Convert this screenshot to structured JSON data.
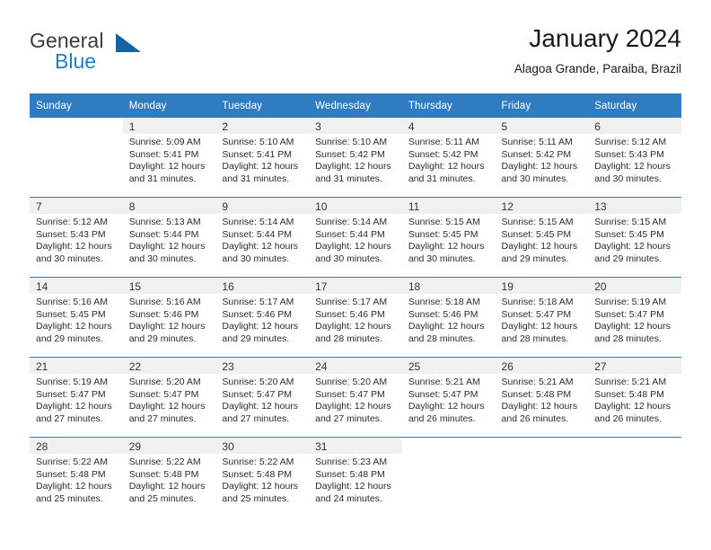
{
  "brand": {
    "name_part1": "General",
    "name_part2": "Blue",
    "mark": "triangle-logo",
    "color_primary": "#1d7dc4",
    "color_text": "#3b3b3b"
  },
  "header": {
    "title": "January 2024",
    "location": "Alagoa Grande, Paraiba, Brazil"
  },
  "theme": {
    "header_row_bg": "#2f7cc0",
    "daynum_bg": "#f0f0f0",
    "grid_line": "#2f7cc0",
    "page_bg": "#ffffff"
  },
  "calendar": {
    "weekday_headers": [
      "Sunday",
      "Monday",
      "Tuesday",
      "Wednesday",
      "Thursday",
      "Friday",
      "Saturday"
    ],
    "labels": {
      "sunrise": "Sunrise:",
      "sunset": "Sunset:",
      "daylight": "Daylight:"
    },
    "weeks": [
      [
        {
          "day": "",
          "sunrise": "",
          "sunset": "",
          "daylight_line1": "",
          "daylight_line2": ""
        },
        {
          "day": "1",
          "sunrise": "Sunrise: 5:09 AM",
          "sunset": "Sunset: 5:41 PM",
          "daylight_line1": "Daylight: 12 hours",
          "daylight_line2": "and 31 minutes."
        },
        {
          "day": "2",
          "sunrise": "Sunrise: 5:10 AM",
          "sunset": "Sunset: 5:41 PM",
          "daylight_line1": "Daylight: 12 hours",
          "daylight_line2": "and 31 minutes."
        },
        {
          "day": "3",
          "sunrise": "Sunrise: 5:10 AM",
          "sunset": "Sunset: 5:42 PM",
          "daylight_line1": "Daylight: 12 hours",
          "daylight_line2": "and 31 minutes."
        },
        {
          "day": "4",
          "sunrise": "Sunrise: 5:11 AM",
          "sunset": "Sunset: 5:42 PM",
          "daylight_line1": "Daylight: 12 hours",
          "daylight_line2": "and 31 minutes."
        },
        {
          "day": "5",
          "sunrise": "Sunrise: 5:11 AM",
          "sunset": "Sunset: 5:42 PM",
          "daylight_line1": "Daylight: 12 hours",
          "daylight_line2": "and 30 minutes."
        },
        {
          "day": "6",
          "sunrise": "Sunrise: 5:12 AM",
          "sunset": "Sunset: 5:43 PM",
          "daylight_line1": "Daylight: 12 hours",
          "daylight_line2": "and 30 minutes."
        }
      ],
      [
        {
          "day": "7",
          "sunrise": "Sunrise: 5:12 AM",
          "sunset": "Sunset: 5:43 PM",
          "daylight_line1": "Daylight: 12 hours",
          "daylight_line2": "and 30 minutes."
        },
        {
          "day": "8",
          "sunrise": "Sunrise: 5:13 AM",
          "sunset": "Sunset: 5:44 PM",
          "daylight_line1": "Daylight: 12 hours",
          "daylight_line2": "and 30 minutes."
        },
        {
          "day": "9",
          "sunrise": "Sunrise: 5:14 AM",
          "sunset": "Sunset: 5:44 PM",
          "daylight_line1": "Daylight: 12 hours",
          "daylight_line2": "and 30 minutes."
        },
        {
          "day": "10",
          "sunrise": "Sunrise: 5:14 AM",
          "sunset": "Sunset: 5:44 PM",
          "daylight_line1": "Daylight: 12 hours",
          "daylight_line2": "and 30 minutes."
        },
        {
          "day": "11",
          "sunrise": "Sunrise: 5:15 AM",
          "sunset": "Sunset: 5:45 PM",
          "daylight_line1": "Daylight: 12 hours",
          "daylight_line2": "and 30 minutes."
        },
        {
          "day": "12",
          "sunrise": "Sunrise: 5:15 AM",
          "sunset": "Sunset: 5:45 PM",
          "daylight_line1": "Daylight: 12 hours",
          "daylight_line2": "and 29 minutes."
        },
        {
          "day": "13",
          "sunrise": "Sunrise: 5:15 AM",
          "sunset": "Sunset: 5:45 PM",
          "daylight_line1": "Daylight: 12 hours",
          "daylight_line2": "and 29 minutes."
        }
      ],
      [
        {
          "day": "14",
          "sunrise": "Sunrise: 5:16 AM",
          "sunset": "Sunset: 5:45 PM",
          "daylight_line1": "Daylight: 12 hours",
          "daylight_line2": "and 29 minutes."
        },
        {
          "day": "15",
          "sunrise": "Sunrise: 5:16 AM",
          "sunset": "Sunset: 5:46 PM",
          "daylight_line1": "Daylight: 12 hours",
          "daylight_line2": "and 29 minutes."
        },
        {
          "day": "16",
          "sunrise": "Sunrise: 5:17 AM",
          "sunset": "Sunset: 5:46 PM",
          "daylight_line1": "Daylight: 12 hours",
          "daylight_line2": "and 29 minutes."
        },
        {
          "day": "17",
          "sunrise": "Sunrise: 5:17 AM",
          "sunset": "Sunset: 5:46 PM",
          "daylight_line1": "Daylight: 12 hours",
          "daylight_line2": "and 28 minutes."
        },
        {
          "day": "18",
          "sunrise": "Sunrise: 5:18 AM",
          "sunset": "Sunset: 5:46 PM",
          "daylight_line1": "Daylight: 12 hours",
          "daylight_line2": "and 28 minutes."
        },
        {
          "day": "19",
          "sunrise": "Sunrise: 5:18 AM",
          "sunset": "Sunset: 5:47 PM",
          "daylight_line1": "Daylight: 12 hours",
          "daylight_line2": "and 28 minutes."
        },
        {
          "day": "20",
          "sunrise": "Sunrise: 5:19 AM",
          "sunset": "Sunset: 5:47 PM",
          "daylight_line1": "Daylight: 12 hours",
          "daylight_line2": "and 28 minutes."
        }
      ],
      [
        {
          "day": "21",
          "sunrise": "Sunrise: 5:19 AM",
          "sunset": "Sunset: 5:47 PM",
          "daylight_line1": "Daylight: 12 hours",
          "daylight_line2": "and 27 minutes."
        },
        {
          "day": "22",
          "sunrise": "Sunrise: 5:20 AM",
          "sunset": "Sunset: 5:47 PM",
          "daylight_line1": "Daylight: 12 hours",
          "daylight_line2": "and 27 minutes."
        },
        {
          "day": "23",
          "sunrise": "Sunrise: 5:20 AM",
          "sunset": "Sunset: 5:47 PM",
          "daylight_line1": "Daylight: 12 hours",
          "daylight_line2": "and 27 minutes."
        },
        {
          "day": "24",
          "sunrise": "Sunrise: 5:20 AM",
          "sunset": "Sunset: 5:47 PM",
          "daylight_line1": "Daylight: 12 hours",
          "daylight_line2": "and 27 minutes."
        },
        {
          "day": "25",
          "sunrise": "Sunrise: 5:21 AM",
          "sunset": "Sunset: 5:47 PM",
          "daylight_line1": "Daylight: 12 hours",
          "daylight_line2": "and 26 minutes."
        },
        {
          "day": "26",
          "sunrise": "Sunrise: 5:21 AM",
          "sunset": "Sunset: 5:48 PM",
          "daylight_line1": "Daylight: 12 hours",
          "daylight_line2": "and 26 minutes."
        },
        {
          "day": "27",
          "sunrise": "Sunrise: 5:21 AM",
          "sunset": "Sunset: 5:48 PM",
          "daylight_line1": "Daylight: 12 hours",
          "daylight_line2": "and 26 minutes."
        }
      ],
      [
        {
          "day": "28",
          "sunrise": "Sunrise: 5:22 AM",
          "sunset": "Sunset: 5:48 PM",
          "daylight_line1": "Daylight: 12 hours",
          "daylight_line2": "and 25 minutes."
        },
        {
          "day": "29",
          "sunrise": "Sunrise: 5:22 AM",
          "sunset": "Sunset: 5:48 PM",
          "daylight_line1": "Daylight: 12 hours",
          "daylight_line2": "and 25 minutes."
        },
        {
          "day": "30",
          "sunrise": "Sunrise: 5:22 AM",
          "sunset": "Sunset: 5:48 PM",
          "daylight_line1": "Daylight: 12 hours",
          "daylight_line2": "and 25 minutes."
        },
        {
          "day": "31",
          "sunrise": "Sunrise: 5:23 AM",
          "sunset": "Sunset: 5:48 PM",
          "daylight_line1": "Daylight: 12 hours",
          "daylight_line2": "and 24 minutes."
        },
        {
          "day": "",
          "sunrise": "",
          "sunset": "",
          "daylight_line1": "",
          "daylight_line2": ""
        },
        {
          "day": "",
          "sunrise": "",
          "sunset": "",
          "daylight_line1": "",
          "daylight_line2": ""
        },
        {
          "day": "",
          "sunrise": "",
          "sunset": "",
          "daylight_line1": "",
          "daylight_line2": ""
        }
      ]
    ]
  }
}
